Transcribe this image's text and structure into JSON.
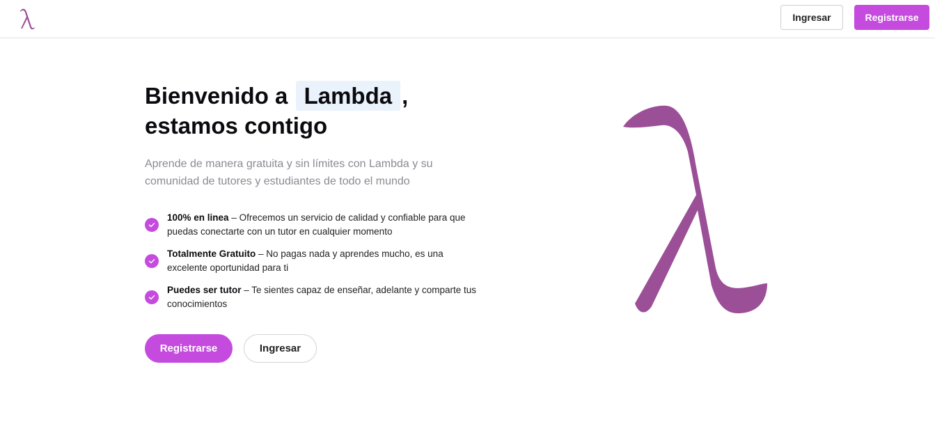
{
  "header": {
    "logo_icon": "lambda-icon",
    "login_label": "Ingresar",
    "register_label": "Registrarse"
  },
  "hero": {
    "title_prefix": "Bienvenido a",
    "title_highlight": "Lambda",
    "title_comma": ",",
    "title_line2": "estamos contigo",
    "subtitle": "Aprende de manera gratuita y sin límites con Lambda y su comunidad de tutores y estudiantes de todo el mundo",
    "features": [
      {
        "title": "100% en linea",
        "text": " – Ofrecemos un servicio de calidad y confiable para que puedas conectarte con un tutor en cualquier momento"
      },
      {
        "title": "Totalmente Gratuito",
        "text": " – No pagas nada y aprendes mucho, es una excelente oportunidad para ti"
      },
      {
        "title": "Puedes ser tutor",
        "text": " – Te sientes capaz de enseñar, adelante y comparte tus conocimientos"
      }
    ],
    "cta_register_label": "Registrarse",
    "cta_login_label": "Ingresar",
    "art_icon": "lambda-illustration"
  },
  "colors": {
    "accent": "#c44bde",
    "lambda": "#9b4f97",
    "highlight_bg": "#eaf2fb",
    "subtitle": "#8a8a92"
  }
}
